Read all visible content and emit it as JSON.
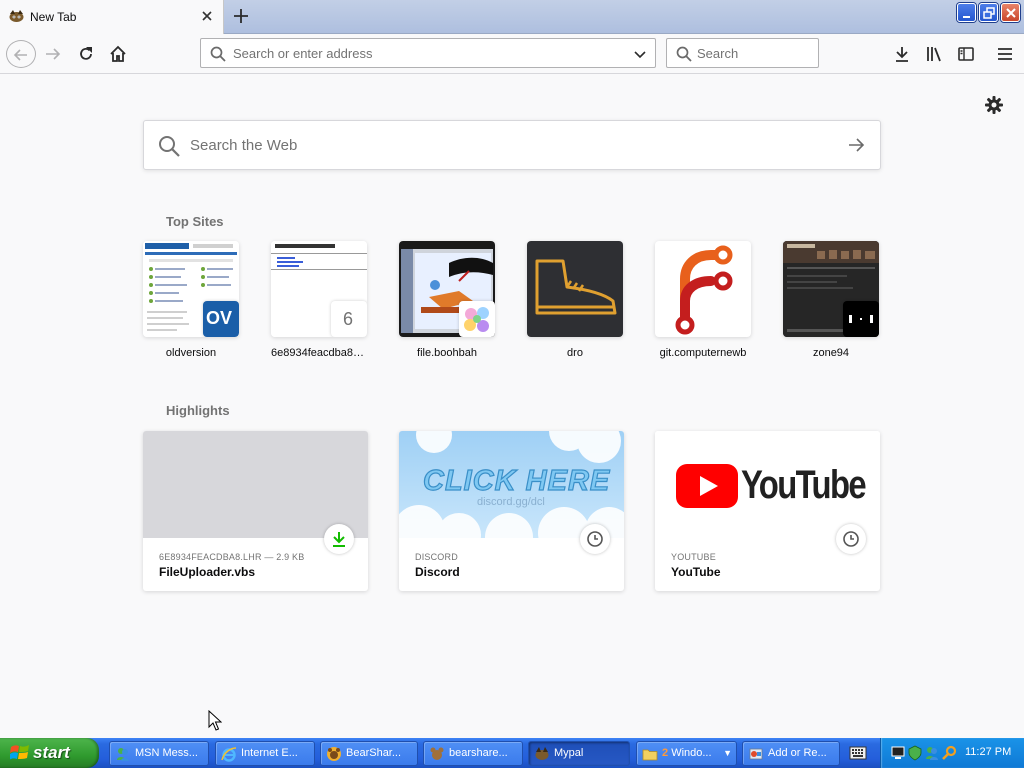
{
  "tab": {
    "title": "New Tab",
    "icon": "firefox-tab-icon"
  },
  "toolbar": {
    "url_placeholder": "Search or enter address",
    "search_placeholder": "Search"
  },
  "newtab": {
    "websearch_placeholder": "Search the Web",
    "topsites_title": "Top Sites",
    "highlights_title": "Highlights",
    "topsites": [
      {
        "label": "oldversion",
        "favicon_text": "OV"
      },
      {
        "label": "6e8934feacdba8.l...",
        "favicon_text": "6"
      },
      {
        "label": "file.boohbah"
      },
      {
        "label": "dro"
      },
      {
        "label": "git.computernewb"
      },
      {
        "label": "zone94"
      }
    ],
    "highlights": [
      {
        "context": "6E8934FEACDBA8.LHR — 2.9 KB",
        "title": "FileUploader.vbs",
        "badge": "download-icon"
      },
      {
        "context": "DISCORD",
        "title": "Discord",
        "badge": "clock-icon",
        "image_text": "CLICK HERE",
        "image_subtext": "discord.gg/dcl"
      },
      {
        "context": "YOUTUBE",
        "title": "YouTube",
        "badge": "clock-icon",
        "image_text": "YouTube"
      }
    ]
  },
  "taskbar": {
    "start_label": "start",
    "buttons": [
      {
        "label": "MSN Mess...",
        "icon": "msn-icon"
      },
      {
        "label": "Internet E...",
        "icon": "ie-icon"
      },
      {
        "label": "BearShar...",
        "icon": "bearshare-icon"
      },
      {
        "label": "bearshare...",
        "icon": "bearshare-file-icon"
      },
      {
        "label": "Mypal",
        "icon": "mypal-icon",
        "active": true
      },
      {
        "count": "2",
        "label": "Windo...",
        "icon": "folder-icon"
      },
      {
        "label": "Add or Re...",
        "icon": "add-remove-icon"
      }
    ],
    "clock": "11:27 PM"
  },
  "colors": {
    "accent": "#0060df",
    "download_green": "#12bc00",
    "youtube_red": "#ff0000",
    "taskbar_blue": "#245edb",
    "start_green": "#2f9a2e"
  }
}
